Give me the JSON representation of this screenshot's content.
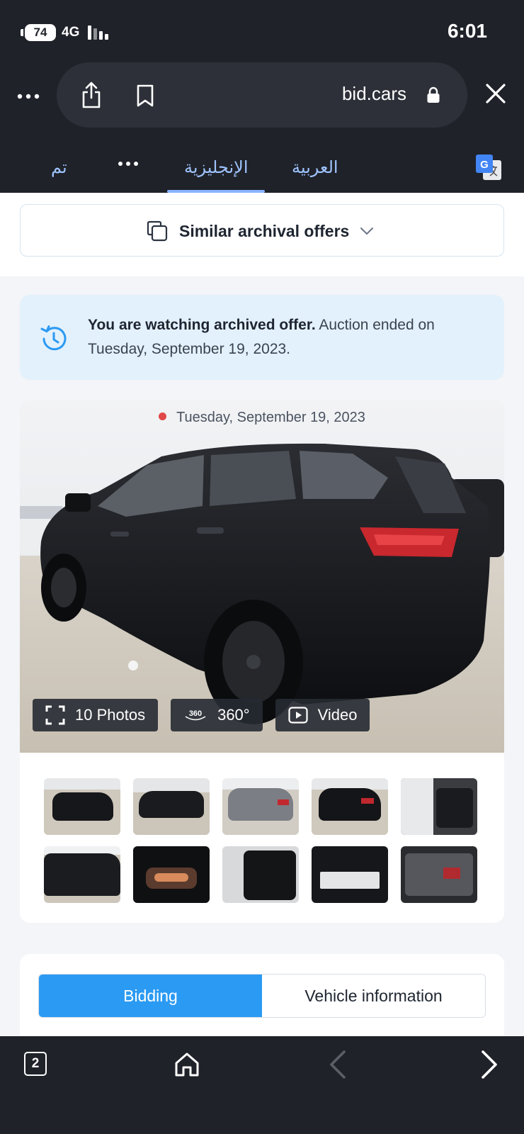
{
  "status_bar": {
    "battery": "74",
    "network": "4G",
    "time": "6:01"
  },
  "browser": {
    "url": "bid.cars",
    "icons": [
      "more-icon",
      "share-icon",
      "bookmark-icon",
      "lock-icon",
      "close-icon"
    ]
  },
  "translation_bar": {
    "done": "تم",
    "english": "الإنجليزية",
    "arabic": "العربية",
    "selected": "english",
    "icons": [
      "more-icon",
      "google-translate-icon"
    ]
  },
  "similar": {
    "label": "Similar archival offers"
  },
  "notice": {
    "bold": "You are watching archived offer.",
    "text": " Auction ended on Tuesday, September 19, 2023."
  },
  "gallery": {
    "date": "Tuesday, September 19, 2023",
    "photos_label": "10 Photos",
    "spin_badge": "360",
    "spin_label": "360°",
    "video_label": "Video",
    "thumbnails": [
      {
        "kind": "rear-left"
      },
      {
        "kind": "front-left"
      },
      {
        "kind": "rear-right-grey"
      },
      {
        "kind": "rear-right"
      },
      {
        "kind": "interior-door"
      },
      {
        "kind": "side-damage"
      },
      {
        "kind": "dashboard"
      },
      {
        "kind": "seats"
      },
      {
        "kind": "label"
      },
      {
        "kind": "engine"
      }
    ]
  },
  "tabs": {
    "bidding": "Bidding",
    "vehicle_info": "Vehicle information",
    "active": "bidding"
  },
  "bottom_bar": {
    "tab_count": "2",
    "icons": [
      "home-icon",
      "back-icon",
      "forward-icon"
    ]
  },
  "colors": {
    "chrome": "#1f2229",
    "accent": "#2b9af3",
    "notice_bg": "#e3f1fd",
    "live_dot": "#e04848",
    "translate_accent": "#8ab4ff"
  }
}
